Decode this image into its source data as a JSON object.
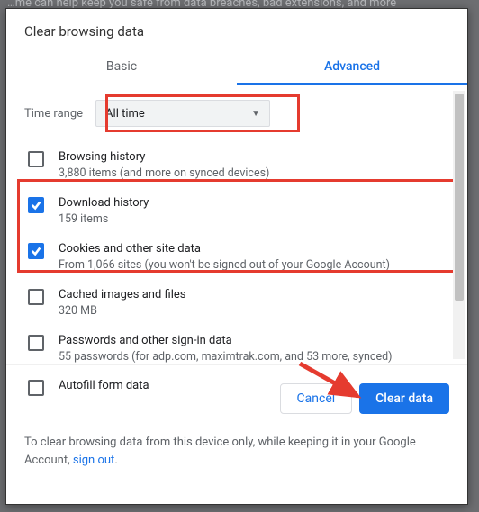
{
  "backdrop_hint": "…me can help keep you safe from data breaches, bad extensions, and more",
  "dialog": {
    "title": "Clear browsing data",
    "tabs": {
      "basic": "Basic",
      "advanced": "Advanced"
    },
    "time_range": {
      "label": "Time range",
      "value": "All time"
    },
    "items": [
      {
        "title": "Browsing history",
        "sub": "3,880 items (and more on synced devices)",
        "checked": false
      },
      {
        "title": "Download history",
        "sub": "159 items",
        "checked": true
      },
      {
        "title": "Cookies and other site data",
        "sub": "From 1,066 sites (you won't be signed out of your Google Account)",
        "checked": true
      },
      {
        "title": "Cached images and files",
        "sub": "320 MB",
        "checked": false
      },
      {
        "title": "Passwords and other sign-in data",
        "sub": "55 passwords (for adp.com, maximtrak.com, and 53 more, synced)",
        "checked": false
      },
      {
        "title": "Autofill form data",
        "sub": "",
        "checked": false
      }
    ],
    "buttons": {
      "cancel": "Cancel",
      "confirm": "Clear data"
    },
    "footer": {
      "text": "To clear browsing data from this device only, while keeping it in your Google Account, ",
      "link": "sign out",
      "tail": "."
    }
  },
  "annotation_color": "#e53b2f"
}
